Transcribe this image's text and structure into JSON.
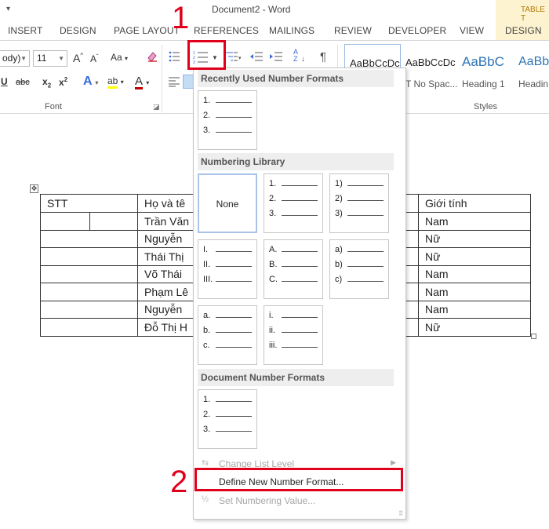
{
  "window": {
    "title": "Document2 - Word",
    "context_tab_group": "TABLE T"
  },
  "tabs": [
    "INSERT",
    "DESIGN",
    "PAGE LAYOUT",
    "REFERENCES",
    "MAILINGS",
    "REVIEW",
    "DEVELOPER",
    "VIEW"
  ],
  "table_design_tab": "DESIGN",
  "ribbon": {
    "font_name": "ody)",
    "font_size": "11",
    "grow_font": "A",
    "shrink_font": "A",
    "change_case": "Aa",
    "underline": "U",
    "strikethrough": "abc",
    "subscript": "x",
    "subscript_digit": "2",
    "superscript": "x",
    "superscript_digit": "2",
    "text_effects": "A",
    "highlight": "ab",
    "font_color": "A",
    "sort": "A Z",
    "pilcrow": "¶",
    "font_group_label": "Font",
    "styles_group_label": "Styles",
    "styles": [
      {
        "sample": "AaBbCcDc",
        "name": ""
      },
      {
        "sample": "AaBbCcDc",
        "name": "T No Spac..."
      },
      {
        "sample": "AaBbC",
        "name": "Heading 1"
      },
      {
        "sample": "AaBbC",
        "name": "Headin"
      }
    ]
  },
  "table": {
    "headers": [
      "STT",
      "Họ và tê",
      "Giới tính"
    ],
    "rows": [
      {
        "name": "Trần Văn",
        "gender": "Nam"
      },
      {
        "name": "Nguyễn",
        "gender": "Nữ"
      },
      {
        "name": "Thái Thị",
        "gender": "Nữ"
      },
      {
        "name": "Võ Thái",
        "gender": "Nam"
      },
      {
        "name": "Phạm Lê",
        "gender": "Nam"
      },
      {
        "name": "Nguyễn",
        "gender": "Nam"
      },
      {
        "name": "Đỗ Thị H",
        "gender": "Nữ"
      }
    ]
  },
  "numbering_menu": {
    "recent_header": "Recently Used Number Formats",
    "library_header": "Numbering Library",
    "document_header": "Document Number Formats",
    "none_label": "None",
    "recent_formats": [
      [
        "1.",
        "2.",
        "3."
      ]
    ],
    "library_formats": [
      [
        "1.",
        "2.",
        "3."
      ],
      [
        "1)",
        "2)",
        "3)"
      ],
      [
        "I.",
        "II.",
        "III."
      ],
      [
        "A.",
        "B.",
        "C."
      ],
      [
        "a)",
        "b)",
        "c)"
      ],
      [
        "a.",
        "b.",
        "c."
      ],
      [
        "i.",
        "ii.",
        "iii."
      ]
    ],
    "document_formats": [
      [
        "1.",
        "2.",
        "3."
      ]
    ],
    "items": {
      "change_level": "Change List Level",
      "define_new": "Define New Number Format...",
      "set_value": "Set Numbering Value..."
    }
  },
  "annotations": {
    "step1": "1",
    "step2": "2"
  },
  "colors": {
    "annotation_red": "#e0001b",
    "context_tab_bg": "#fdf3d1",
    "context_tab_text": "#b27a00",
    "style_heading_blue": "#2e74b5",
    "font_color_red": "#c00000",
    "highlight_yellow": "#ffff00"
  }
}
